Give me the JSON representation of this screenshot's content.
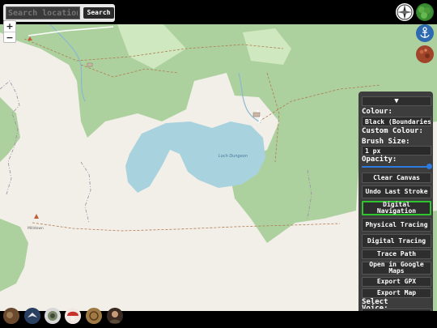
{
  "search": {
    "placeholder": "Search location",
    "button_label": "Search"
  },
  "zoom": {
    "in_label": "+",
    "out_label": "−"
  },
  "map_labels": {
    "loch": "Loch Dungeon",
    "village": "Milldown"
  },
  "panel": {
    "collapse_label": "▼",
    "colour_label": "Colour:",
    "colour_value": "Black (Boundaries)",
    "custom_colour_label": "Custom Colour:",
    "brush_size_label": "Brush Size:",
    "brush_size_value": "1 px",
    "opacity_label": "Opacity:",
    "opacity_value": 1.0,
    "buttons": {
      "clear_canvas": "Clear Canvas",
      "undo_last_stroke": "Undo Last Stroke",
      "digital_navigation": "Digital Navigation",
      "physical_tracing": "Physical Tracing",
      "digital_tracing": "Digital Tracing",
      "trace_path": "Trace Path",
      "open_in_google_maps": "Open in Google Maps",
      "export_gpx": "Export GPX",
      "export_map": "Export Map"
    },
    "select_voice_label": "Select Voice:"
  },
  "colors": {
    "panel_bg": "#3d3d3d",
    "active_outline": "#2fc52f",
    "loch": "#a8d2de",
    "woodland": "#add19e"
  }
}
